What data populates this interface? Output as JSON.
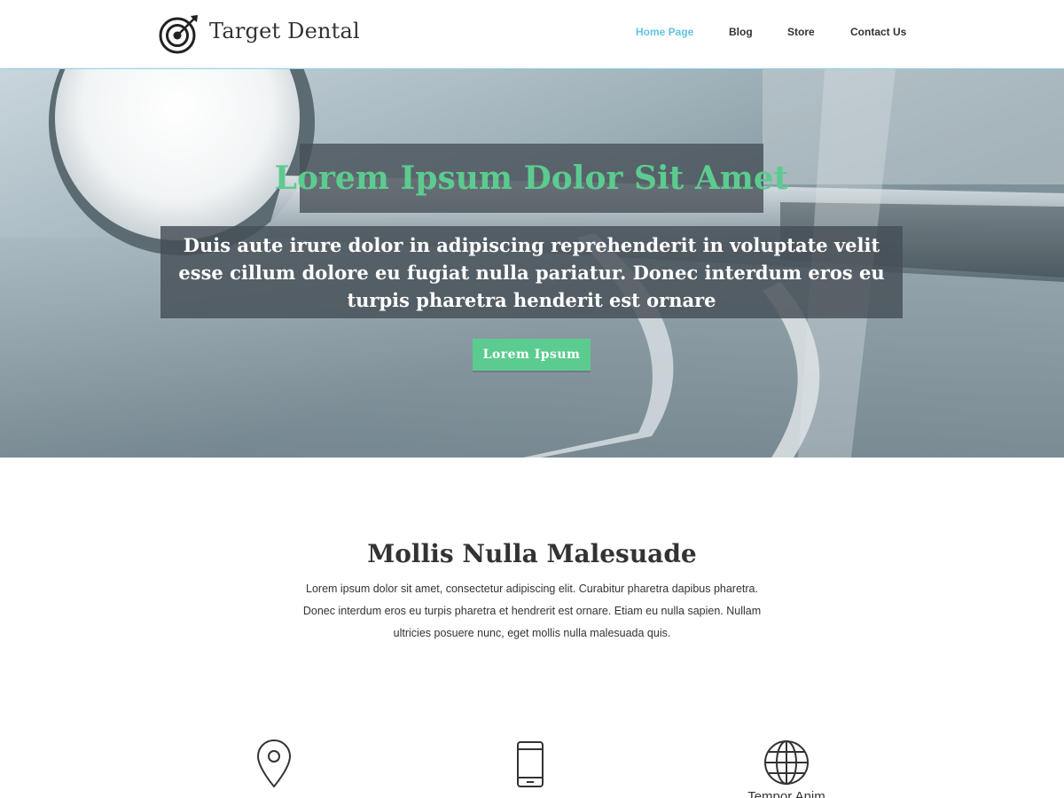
{
  "header": {
    "brand": "Target Dental",
    "logo_icon": "target-dart-icon",
    "nav": [
      {
        "label": "Home Page",
        "active": true
      },
      {
        "label": "Blog",
        "active": false
      },
      {
        "label": "Store",
        "active": false
      },
      {
        "label": "Contact Us",
        "active": false
      }
    ]
  },
  "hero": {
    "title": "Lorem Ipsum Dolor Sit Amet",
    "subtitle": "Duis aute irure dolor in adipiscing reprehenderit in voluptate velit esse cillum dolore eu fugiat nulla pariatur. Donec interdum eros eu turpis pharetra henderit est ornare",
    "button_label": "Lorem Ipsum",
    "background": "dental-tools-photo"
  },
  "section": {
    "title": "Mollis Nulla Malesuade",
    "text": "Lorem ipsum dolor sit amet, consectetur adipiscing elit. Curabitur pharetra dapibus pharetra. Donec interdum eros eu turpis pharetra et hendrerit est ornare. Etiam eu nulla sapien. Nullam ultricies posuere nunc, eget mollis nulla malesuada quis."
  },
  "features": [
    {
      "icon": "map-pin-icon"
    },
    {
      "icon": "mobile-phone-icon"
    },
    {
      "icon": "globe-icon",
      "label": "Tempor Anim"
    }
  ],
  "colors": {
    "accent_green": "#5ccb8f",
    "nav_active": "#62c4e2",
    "text": "#333333",
    "overlay": "#464e56"
  }
}
